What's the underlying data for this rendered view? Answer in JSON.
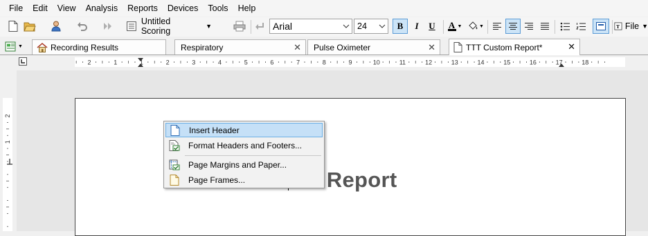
{
  "menubar": {
    "items": [
      {
        "label": "File"
      },
      {
        "label": "Edit"
      },
      {
        "label": "View"
      },
      {
        "label": "Analysis"
      },
      {
        "label": "Reports"
      },
      {
        "label": "Devices"
      },
      {
        "label": "Tools"
      },
      {
        "label": "Help"
      }
    ]
  },
  "toolbar": {
    "scoring_label": "Untitled Scoring",
    "font_name": "Arial",
    "font_size": "24",
    "bold_label": "B",
    "italic_label": "I",
    "underline_label": "U",
    "font_color_label": "A",
    "file_label": "File",
    "colors": {
      "accent": "#5b9bd5",
      "font_color_bar": "#000000"
    }
  },
  "tabs": [
    {
      "label": "Recording Results"
    },
    {
      "label": "Respiratory",
      "close": "✕"
    },
    {
      "label": "Pulse Oximeter",
      "close": "✕"
    },
    {
      "label": "TTT Custom Report*",
      "close": "✕"
    }
  ],
  "ruler": {
    "labels": [
      "2",
      "1",
      "1",
      "2",
      "3",
      "4",
      "5",
      "6",
      "7",
      "8",
      "9",
      "10",
      "11",
      "12",
      "13",
      "14",
      "15",
      "16",
      "17",
      "18"
    ],
    "vlabels": [
      "2",
      "1"
    ]
  },
  "document": {
    "heading": "G Report"
  },
  "context_menu": {
    "items": [
      {
        "label": "Insert Header",
        "icon": "page-icon"
      },
      {
        "label": "Format Headers and Footers...",
        "icon": "page-check-icon"
      },
      {
        "label": "Page Margins and Paper...",
        "icon": "margins-check-icon"
      },
      {
        "label": "Page Frames...",
        "icon": "page-frame-icon"
      }
    ]
  }
}
